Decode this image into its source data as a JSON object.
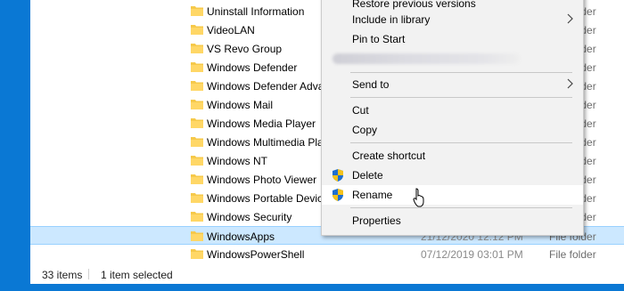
{
  "files": [
    {
      "name": "Uninstall Information",
      "date": "",
      "type": "File folder",
      "selected": false
    },
    {
      "name": "VideoLAN",
      "date": "",
      "type": "File folder",
      "selected": false
    },
    {
      "name": "VS Revo Group",
      "date": "",
      "type": "File folder",
      "selected": false
    },
    {
      "name": "Windows Defender",
      "date": "",
      "type": "File folder",
      "selected": false
    },
    {
      "name": "Windows Defender Advanced Threat Protection",
      "date": "",
      "type": "File folder",
      "selected": false
    },
    {
      "name": "Windows Mail",
      "date": "",
      "type": "File folder",
      "selected": false
    },
    {
      "name": "Windows Media Player",
      "date": "",
      "type": "File folder",
      "selected": false
    },
    {
      "name": "Windows Multimedia Platform",
      "date": "",
      "type": "File folder",
      "selected": false
    },
    {
      "name": "Windows NT",
      "date": "",
      "type": "File folder",
      "selected": false
    },
    {
      "name": "Windows Photo Viewer",
      "date": "",
      "type": "File folder",
      "selected": false
    },
    {
      "name": "Windows Portable Devices",
      "date": "",
      "type": "File folder",
      "selected": false
    },
    {
      "name": "Windows Security",
      "date": "",
      "type": "File folder",
      "selected": false
    },
    {
      "name": "WindowsApps",
      "date": "21/12/2020 12:12 PM",
      "type": "File folder",
      "selected": true
    },
    {
      "name": "WindowsPowerShell",
      "date": "07/12/2019 03:01 PM",
      "type": "File folder",
      "selected": false
    }
  ],
  "status": {
    "items": "33 items",
    "selected": "1 item selected"
  },
  "context_menu": {
    "restore": "Restore previous versions",
    "include": "Include in library",
    "pin": "Pin to Start",
    "send_to": "Send to",
    "cut": "Cut",
    "copy": "Copy",
    "create_shortcut": "Create shortcut",
    "delete": "Delete",
    "rename": "Rename",
    "properties": "Properties"
  },
  "colors": {
    "accent": "#0a78d4",
    "selection": "#cce8ff",
    "folder": "#f6c94a"
  }
}
